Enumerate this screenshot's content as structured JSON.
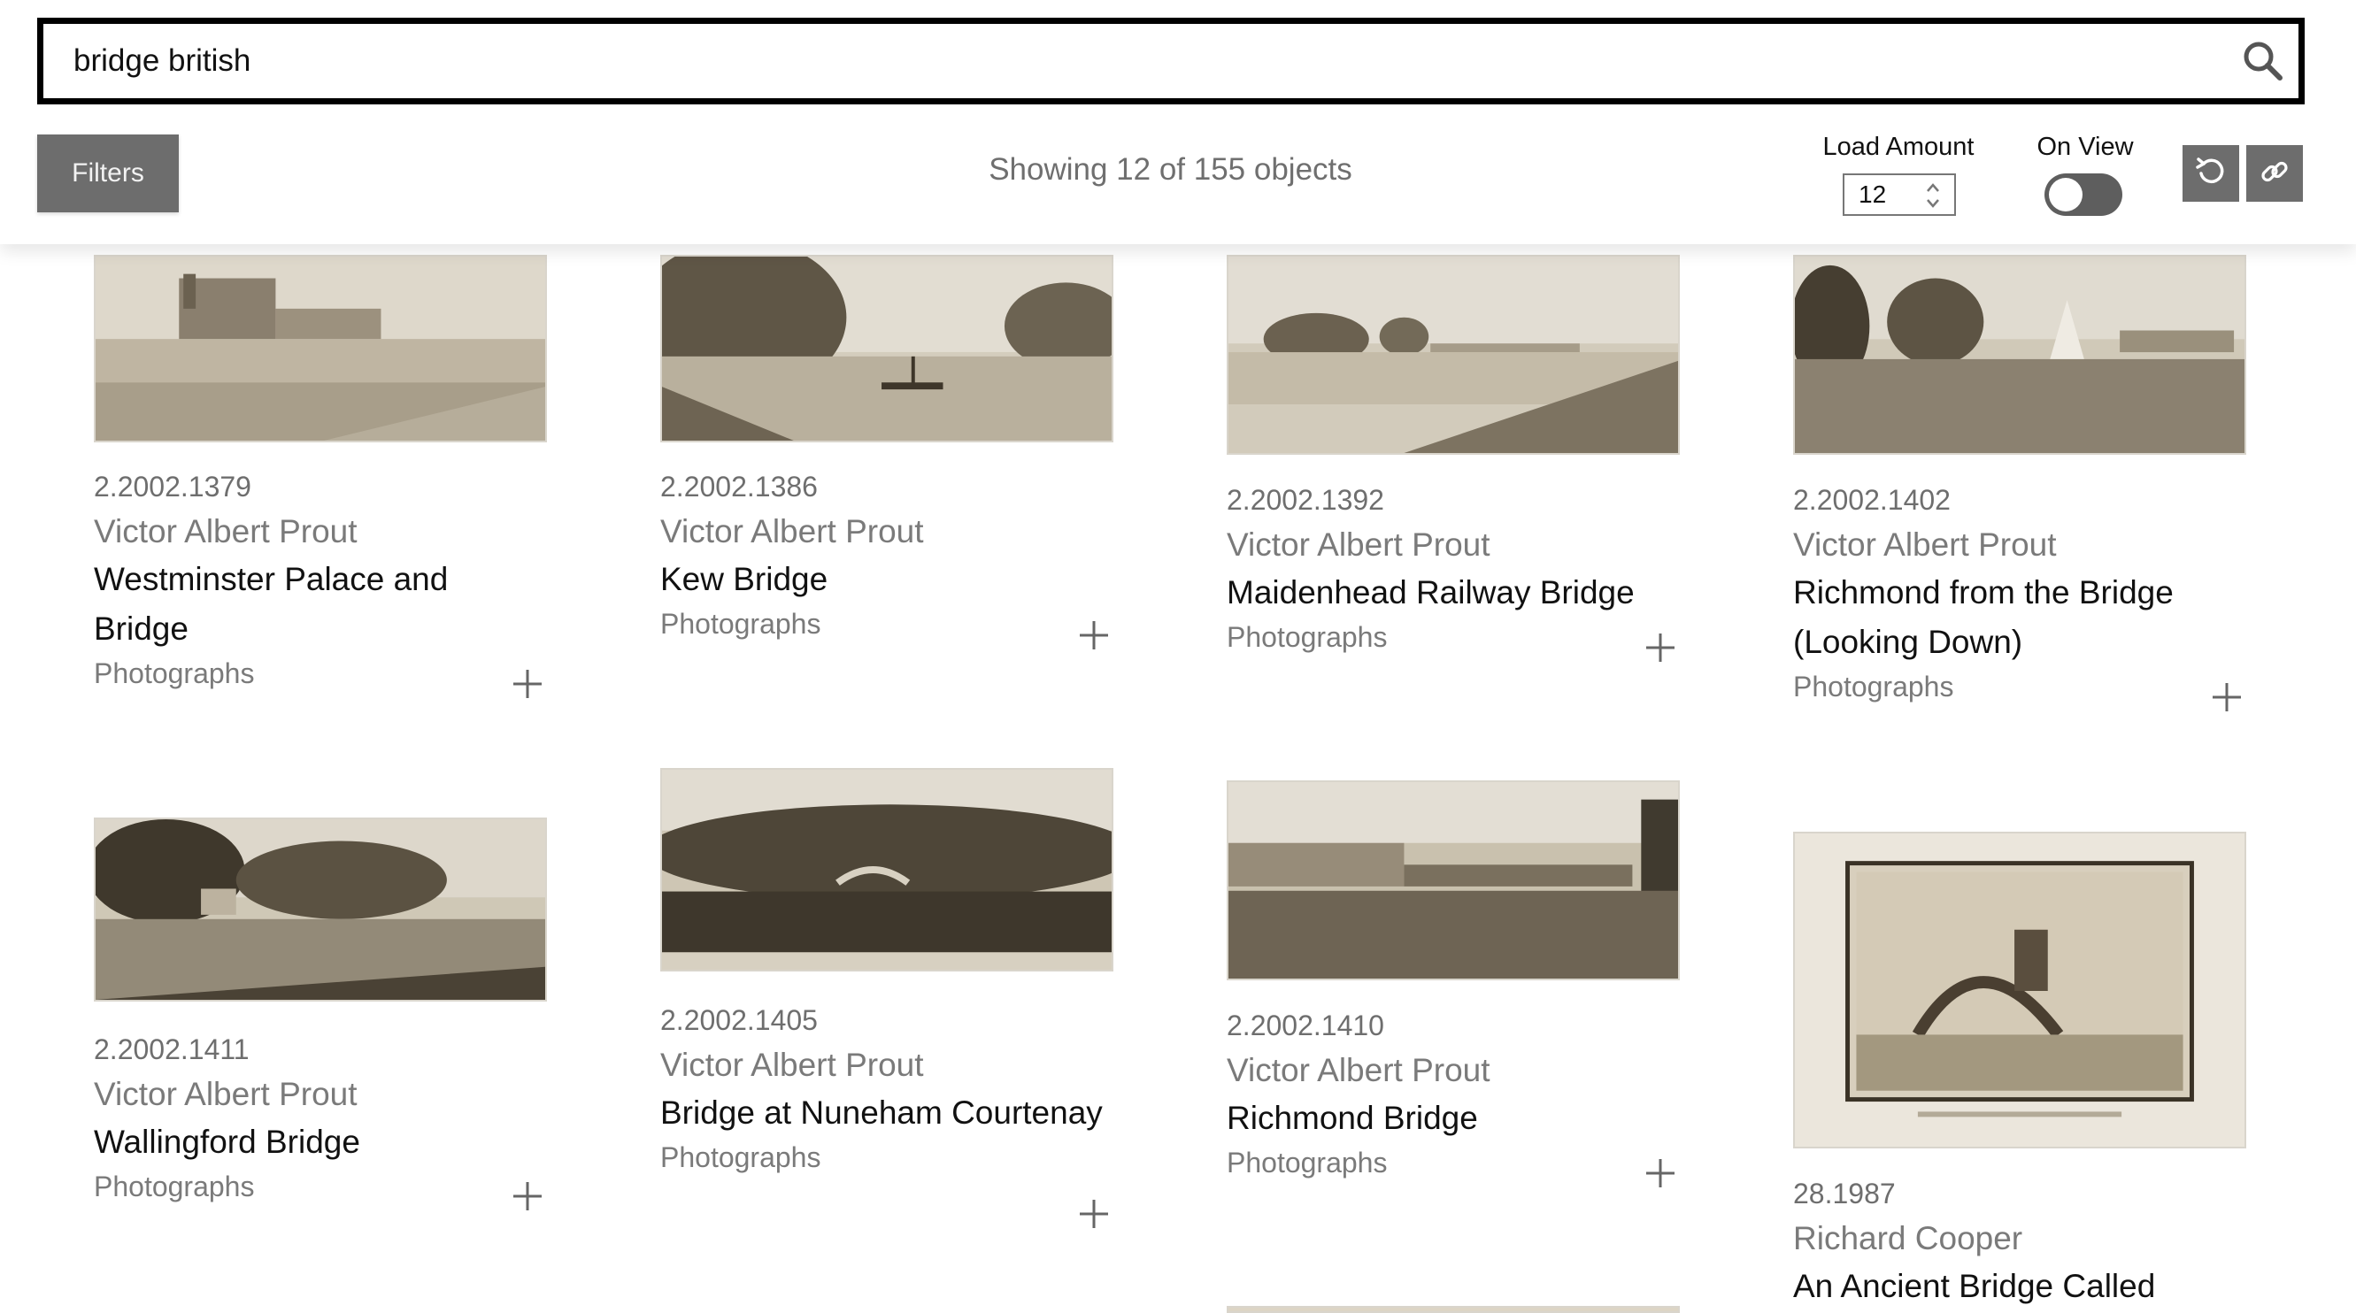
{
  "search": {
    "value": "bridge british",
    "icon": "search-icon"
  },
  "toolbar": {
    "filters_label": "Filters",
    "showing_text": "Showing 12 of 155 objects",
    "load_amount_label": "Load Amount",
    "load_amount_value": "12",
    "on_view_label": "On View",
    "on_view_enabled": false,
    "reset_icon": "reset-icon",
    "link_icon": "link-icon"
  },
  "results": [
    {
      "accession": "2.2002.1379",
      "artist": "Victor Albert Prout",
      "title": "Westminster Palace and Bridge",
      "category": "Photographs"
    },
    {
      "accession": "2.2002.1386",
      "artist": "Victor Albert Prout",
      "title": "Kew Bridge",
      "category": "Photographs"
    },
    {
      "accession": "2.2002.1392",
      "artist": "Victor Albert Prout",
      "title": "Maidenhead Railway Bridge",
      "category": "Photographs"
    },
    {
      "accession": "2.2002.1402",
      "artist": "Victor Albert Prout",
      "title": "Richmond from the Bridge (Looking Down)",
      "category": "Photographs"
    },
    {
      "accession": "2.2002.1411",
      "artist": "Victor Albert Prout",
      "title": "Wallingford Bridge",
      "category": "Photographs"
    },
    {
      "accession": "2.2002.1405",
      "artist": "Victor Albert Prout",
      "title": "Bridge at Nuneham Courtenay",
      "category": "Photographs"
    },
    {
      "accession": "2.2002.1410",
      "artist": "Victor Albert Prout",
      "title": "Richmond Bridge",
      "category": "Photographs"
    },
    {
      "accession": "28.1987",
      "artist": "Richard Cooper",
      "title": "An Ancient Bridge Called",
      "category": ""
    }
  ]
}
